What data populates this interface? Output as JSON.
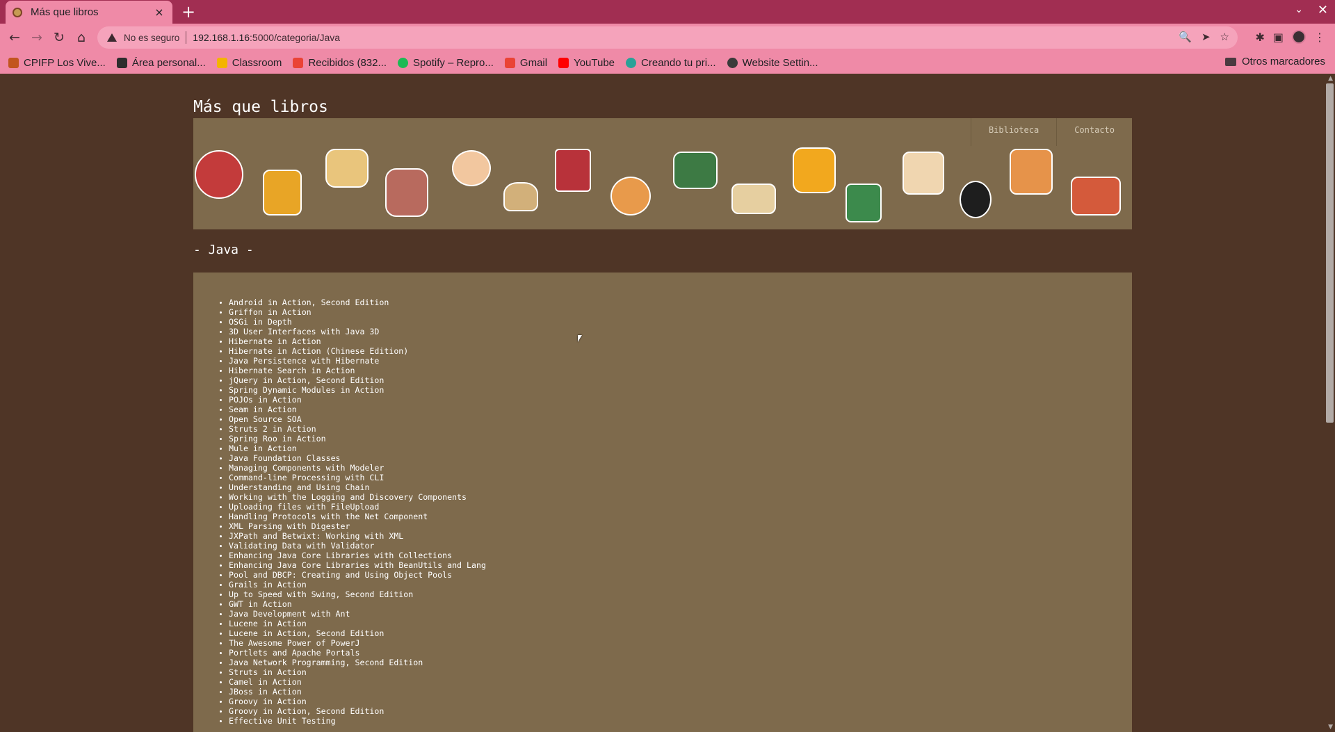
{
  "browser": {
    "tab_title": "Más que libros",
    "tab_close": "×",
    "new_tab": "+",
    "security_label": "No es seguro",
    "url_host": "192.168.1.16",
    "url_path": ":5000/categoria/Java",
    "bookmarks": [
      {
        "label": "CPIFP Los Vive...",
        "color": "#c2551f"
      },
      {
        "label": "Área personal...",
        "color": "#2d2d2d"
      },
      {
        "label": "Classroom",
        "color": "#f4b400"
      },
      {
        "label": "Recibidos (832...",
        "color": "#ea4335"
      },
      {
        "label": "Spotify – Repro...",
        "color": "#1db954"
      },
      {
        "label": "Gmail",
        "color": "#ea4335"
      },
      {
        "label": "YouTube",
        "color": "#ff0000"
      },
      {
        "label": "Creando tu pri...",
        "color": "#2aa198"
      },
      {
        "label": "Website Settin...",
        "color": "#3a3a3a"
      }
    ],
    "other_bookmarks": "Otros marcadores"
  },
  "site": {
    "title": "Más que libros",
    "nav": [
      "Biblioteca",
      "Contacto"
    ],
    "category": "- Java -"
  },
  "books": [
    "Android in Action, Second Edition",
    "Griffon in Action",
    "OSGi in Depth",
    "3D User Interfaces with Java 3D",
    "Hibernate in Action",
    "Hibernate in Action (Chinese Edition)",
    "Java Persistence with Hibernate",
    "Hibernate Search in Action",
    "jQuery in Action, Second Edition",
    "Spring Dynamic Modules in Action",
    "POJOs in Action",
    "Seam in Action",
    "Open Source SOA",
    "Struts 2 in Action",
    "Spring Roo in Action",
    "Mule in Action",
    "Java Foundation Classes",
    "Managing Components with Modeler",
    "Command-line Processing with CLI",
    "Understanding and Using Chain",
    "Working with the Logging and Discovery Components",
    "Uploading files with FileUpload",
    "Handling Protocols with the Net Component",
    "XML Parsing with Digester",
    "JXPath and Betwixt: Working with XML",
    "Validating Data with Validator",
    "Enhancing Java Core Libraries with Collections",
    "Enhancing Java Core Libraries with BeanUtils and Lang",
    "Pool and DBCP: Creating and Using Object Pools",
    "Grails in Action",
    "Up to Speed with Swing, Second Edition",
    "GWT in Action",
    "Java Development with Ant",
    "Lucene in Action",
    "Lucene in Action, Second Edition",
    "The Awesome Power of PowerJ",
    "Portlets and Apache Portals",
    "Java Network Programming, Second Edition",
    "Struts in Action",
    "Camel in Action",
    "JBoss in Action",
    "Groovy in Action",
    "Groovy in Action, Second Edition",
    "Effective Unit Testing"
  ],
  "icons": {
    "back": "back-arrow-icon",
    "forward": "forward-arrow-icon",
    "reload": "reload-icon",
    "home": "home-icon",
    "warning": "warning-icon",
    "zoom": "zoom-icon",
    "share": "send-icon",
    "star": "star-icon",
    "extensions": "puzzle-icon",
    "sidepanel": "side-panel-icon",
    "menu": "kebab-menu-icon"
  },
  "colors": {
    "tab_strip": "#a12e52",
    "toolbar": "#ef8aa7",
    "page_background": "#4f3526",
    "panel": "#7e6a4c"
  }
}
